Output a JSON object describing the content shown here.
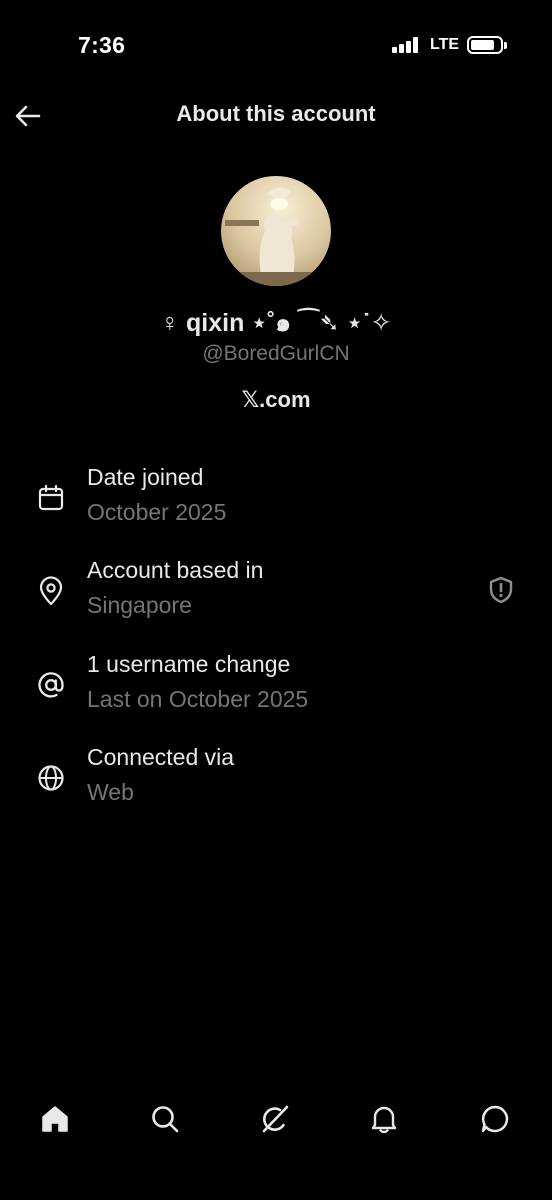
{
  "status_bar": {
    "time": "7:36",
    "network": "LTE"
  },
  "header": {
    "title": "About this account"
  },
  "profile": {
    "display_name": "♀ qixin ⋆˚๑ ⁀➴ ⋆˙✧",
    "handle": "@BoredGurlCN",
    "site": "𝕏.com"
  },
  "details": [
    {
      "label": "Date joined",
      "value": "October 2025",
      "icon": "calendar-icon"
    },
    {
      "label": "Account based in",
      "value": "Singapore",
      "icon": "location-pin-icon"
    },
    {
      "label": "1 username change",
      "value": "Last on October 2025",
      "icon": "at-sign-icon"
    },
    {
      "label": "Connected via",
      "value": "Web",
      "icon": "globe-icon"
    }
  ],
  "bottom_nav": [
    "home-icon",
    "search-icon",
    "grok-icon",
    "notifications-icon",
    "messages-icon"
  ],
  "colors": {
    "background": "#000000",
    "primary_text": "#e7e9ea",
    "secondary_text": "#71767b"
  }
}
